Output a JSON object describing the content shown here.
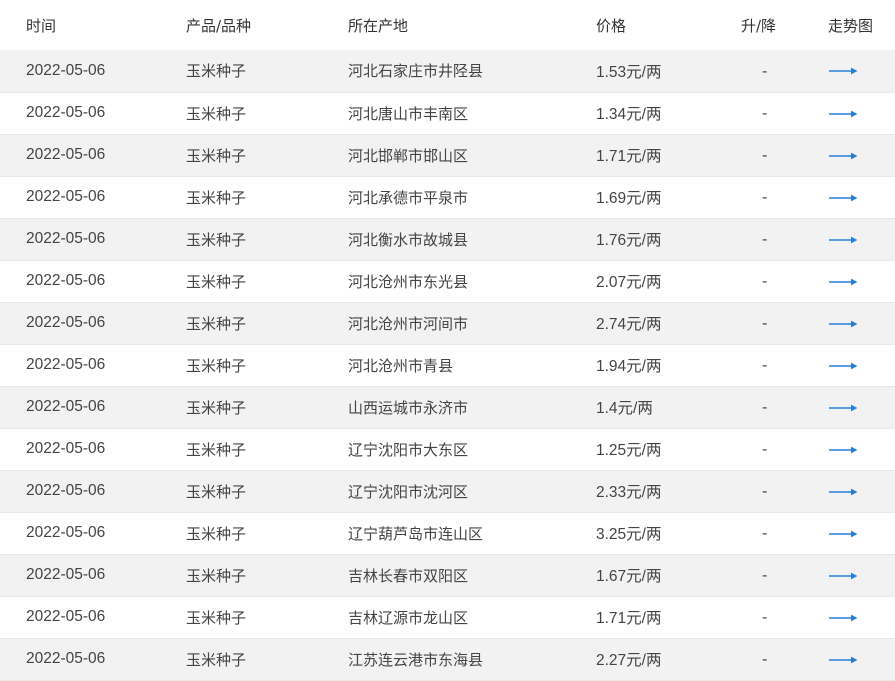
{
  "table": {
    "headers": {
      "time": "时间",
      "product": "产品/品种",
      "origin": "所在产地",
      "price": "价格",
      "change": "升/降",
      "trend": "走势图"
    },
    "rows": [
      {
        "time": "2022-05-06",
        "product": "玉米种子",
        "origin": "河北石家庄市井陉县",
        "price": "1.53元/两",
        "change": "-"
      },
      {
        "time": "2022-05-06",
        "product": "玉米种子",
        "origin": "河北唐山市丰南区",
        "price": "1.34元/两",
        "change": "-"
      },
      {
        "time": "2022-05-06",
        "product": "玉米种子",
        "origin": "河北邯郸市邯山区",
        "price": "1.71元/两",
        "change": "-"
      },
      {
        "time": "2022-05-06",
        "product": "玉米种子",
        "origin": "河北承德市平泉市",
        "price": "1.69元/两",
        "change": "-"
      },
      {
        "time": "2022-05-06",
        "product": "玉米种子",
        "origin": "河北衡水市故城县",
        "price": "1.76元/两",
        "change": "-"
      },
      {
        "time": "2022-05-06",
        "product": "玉米种子",
        "origin": "河北沧州市东光县",
        "price": "2.07元/两",
        "change": "-"
      },
      {
        "time": "2022-05-06",
        "product": "玉米种子",
        "origin": "河北沧州市河间市",
        "price": "2.74元/两",
        "change": "-"
      },
      {
        "time": "2022-05-06",
        "product": "玉米种子",
        "origin": "河北沧州市青县",
        "price": "1.94元/两",
        "change": "-"
      },
      {
        "time": "2022-05-06",
        "product": "玉米种子",
        "origin": "山西运城市永济市",
        "price": "1.4元/两",
        "change": "-"
      },
      {
        "time": "2022-05-06",
        "product": "玉米种子",
        "origin": "辽宁沈阳市大东区",
        "price": "1.25元/两",
        "change": "-"
      },
      {
        "time": "2022-05-06",
        "product": "玉米种子",
        "origin": "辽宁沈阳市沈河区",
        "price": "2.33元/两",
        "change": "-"
      },
      {
        "time": "2022-05-06",
        "product": "玉米种子",
        "origin": "辽宁葫芦岛市连山区",
        "price": "3.25元/两",
        "change": "-"
      },
      {
        "time": "2022-05-06",
        "product": "玉米种子",
        "origin": "吉林长春市双阳区",
        "price": "1.67元/两",
        "change": "-"
      },
      {
        "time": "2022-05-06",
        "product": "玉米种子",
        "origin": "吉林辽源市龙山区",
        "price": "1.71元/两",
        "change": "-"
      },
      {
        "time": "2022-05-06",
        "product": "玉米种子",
        "origin": "江苏连云港市东海县",
        "price": "2.27元/两",
        "change": "-"
      }
    ]
  },
  "icons": {
    "trend": "arrow-right-icon"
  },
  "colors": {
    "trend_arrow": "#2a7fd4",
    "row_stripe": "#f2f2f2",
    "text": "#444444"
  }
}
